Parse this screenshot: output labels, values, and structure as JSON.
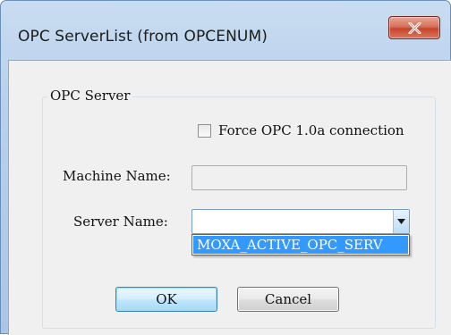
{
  "window": {
    "title": "OPC ServerList (from OPCENUM)",
    "close_icon": "close-x-icon"
  },
  "group": {
    "label": "OPC Server"
  },
  "force_connection": {
    "label": "Force OPC 1.0a connection",
    "checked": false
  },
  "machine": {
    "label": "Machine Name:",
    "value": ""
  },
  "server": {
    "label": "Server Name:",
    "value": "",
    "dropdown_icon": "chevron-down-icon",
    "options": [
      "MOXA_ACTIVE_OPC_SERV"
    ]
  },
  "buttons": {
    "ok": "OK",
    "cancel": "Cancel"
  },
  "colors": {
    "selection": "#3399ff",
    "close_button": "#c8442b"
  }
}
